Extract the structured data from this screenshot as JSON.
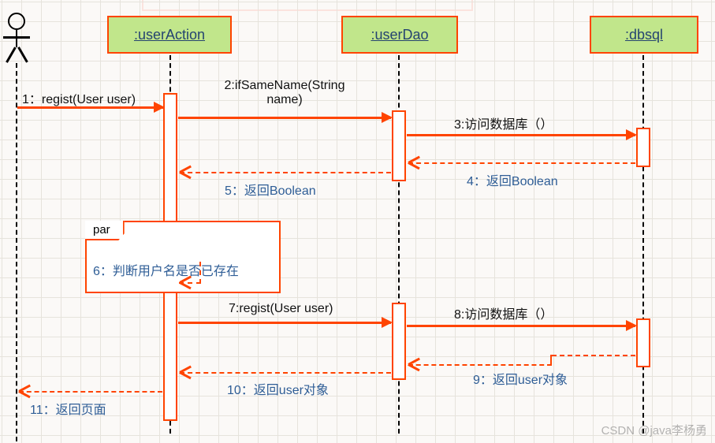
{
  "participants": {
    "userAction": ":userAction",
    "userDao": ":userDao",
    "dbsql": ":dbsql"
  },
  "fragment": {
    "operator": "par"
  },
  "messages": {
    "m1": "1：regist(User user)",
    "m2": "2:ifSameName(String\nname)",
    "m3": "3:访问数据库（）",
    "m4": "4：返回Boolean",
    "m5": "5：返回Boolean",
    "m6": "6：判断用户名是否已存在",
    "m7": "7:regist(User user)",
    "m8": "8:访问数据库（）",
    "m9": "9：返回user对象",
    "m10": "10：返回user对象",
    "m11": "11：返回页面"
  },
  "watermark": "CSDN @java李杨勇",
  "chart_data": {
    "type": "sequence_diagram",
    "participants": [
      "Actor",
      ":userAction",
      ":userDao",
      ":dbsql"
    ],
    "messages": [
      {
        "n": 1,
        "from": "Actor",
        "to": ":userAction",
        "label": "regist(User user)",
        "kind": "sync"
      },
      {
        "n": 2,
        "from": ":userAction",
        "to": ":userDao",
        "label": "ifSameName(String name)",
        "kind": "sync"
      },
      {
        "n": 3,
        "from": ":userDao",
        "to": ":dbsql",
        "label": "访问数据库（）",
        "kind": "sync"
      },
      {
        "n": 4,
        "from": ":dbsql",
        "to": ":userDao",
        "label": "返回Boolean",
        "kind": "return"
      },
      {
        "n": 5,
        "from": ":userDao",
        "to": ":userAction",
        "label": "返回Boolean",
        "kind": "return"
      },
      {
        "n": 6,
        "from": ":userAction",
        "to": ":userAction",
        "label": "判断用户名是否已存在",
        "kind": "self",
        "fragment": "par"
      },
      {
        "n": 7,
        "from": ":userAction",
        "to": ":userDao",
        "label": "regist(User user)",
        "kind": "sync"
      },
      {
        "n": 8,
        "from": ":userDao",
        "to": ":dbsql",
        "label": "访问数据库（）",
        "kind": "sync"
      },
      {
        "n": 9,
        "from": ":dbsql",
        "to": ":userDao",
        "label": "返回user对象",
        "kind": "return"
      },
      {
        "n": 10,
        "from": ":userDao",
        "to": ":userAction",
        "label": "返回user对象",
        "kind": "return"
      },
      {
        "n": 11,
        "from": ":userAction",
        "to": "Actor",
        "label": "返回页面",
        "kind": "return"
      }
    ]
  }
}
